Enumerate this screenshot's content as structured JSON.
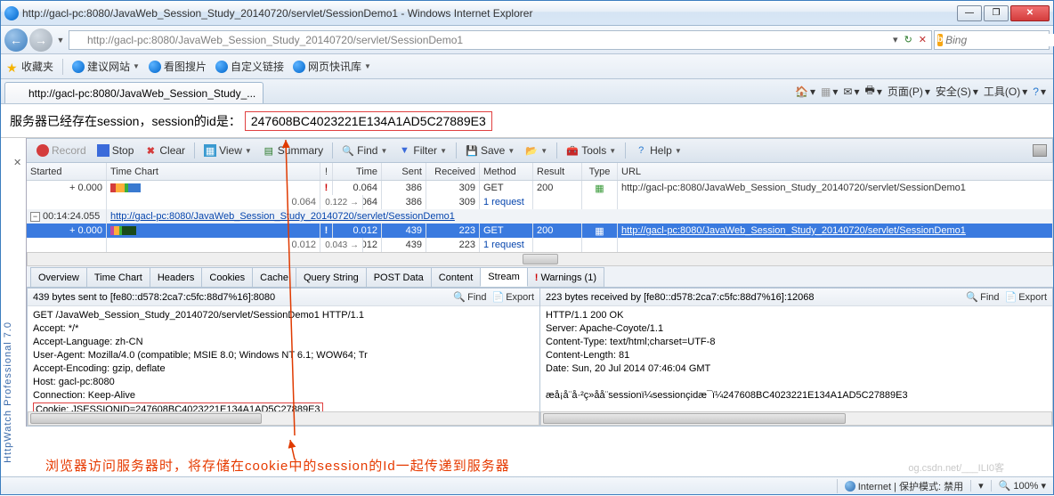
{
  "window": {
    "title": "http://gacl-pc:8080/JavaWeb_Session_Study_20140720/servlet/SessionDemo1 - Windows Internet Explorer"
  },
  "nav": {
    "url": "http://gacl-pc:8080/JavaWeb_Session_Study_20140720/servlet/SessionDemo1",
    "search_placeholder": "Bing"
  },
  "favbar": {
    "favorites": "收藏夹",
    "suggest": "建议网站",
    "images": "看图搜片",
    "custom": "自定义链接",
    "news": "网页快讯库"
  },
  "tab": {
    "label": "http://gacl-pc:8080/JavaWeb_Session_Study_..."
  },
  "cmdbar": {
    "page": "页面(P)",
    "safety": "安全(S)",
    "tools": "工具(O)"
  },
  "page": {
    "prefix": "服务器已经存在session，session的id是：",
    "session_id": "247608BC4023221E134A1AD5C27889E3"
  },
  "toolbar": {
    "record": "Record",
    "stop": "Stop",
    "clear": "Clear",
    "view": "View",
    "summary": "Summary",
    "find": "Find",
    "filter": "Filter",
    "save": "Save",
    "tools": "Tools",
    "help": "Help"
  },
  "grid": {
    "headers": {
      "started": "Started",
      "time_chart": "Time Chart",
      "bang": "!",
      "time": "Time",
      "sent": "Sent",
      "received": "Received",
      "method": "Method",
      "result": "Result",
      "type": "Type",
      "url": "URL"
    },
    "rows": [
      {
        "started": "+ 0.000",
        "bang": "!",
        "time": "0.064",
        "sent": "386",
        "recv": "309",
        "method": "GET",
        "result": "200",
        "url": "http://gacl-pc:8080/JavaWeb_Session_Study_20140720/servlet/SessionDemo1"
      },
      {
        "started": "",
        "tc_right": "0.064",
        "bang_right": "0.122",
        "time": "0.064",
        "sent": "386",
        "recv": "309",
        "method": "1 request",
        "result": "",
        "url": ""
      },
      {
        "group": true,
        "started": "00:14:24.055",
        "url_group": "http://gacl-pc:8080/JavaWeb_Session_Study_20140720/servlet/SessionDemo1"
      },
      {
        "sel": true,
        "started": "+ 0.000",
        "bang": "!",
        "time": "0.012",
        "sent": "439",
        "recv": "223",
        "method": "GET",
        "result": "200",
        "url": "http://gacl-pc:8080/JavaWeb_Session_Study_20140720/servlet/SessionDemo1"
      },
      {
        "started": "",
        "tc_right": "0.012",
        "bang_right": "0.043",
        "time": "0.012",
        "sent": "439",
        "recv": "223",
        "method": "1 request",
        "result": "",
        "url": ""
      }
    ]
  },
  "mid_tabs": {
    "overview": "Overview",
    "time_chart": "Time Chart",
    "headers": "Headers",
    "cookies": "Cookies",
    "cache": "Cache",
    "query": "Query String",
    "post": "POST Data",
    "content": "Content",
    "stream": "Stream",
    "warnings": "Warnings (1)"
  },
  "left_panel": {
    "title": "439 bytes sent to  [fe80::d578:2ca7:c5fc:88d7%16]:8080",
    "find": "Find",
    "export": "Export",
    "l1": "GET /JavaWeb_Session_Study_20140720/servlet/SessionDemo1 HTTP/1.1",
    "l2": "Accept: */*",
    "l3": "Accept-Language: zh-CN",
    "l4": "User-Agent: Mozilla/4.0 (compatible; MSIE 8.0; Windows NT 6.1; WOW64; Tr",
    "l5": "Accept-Encoding: gzip, deflate",
    "l6": "Host: gacl-pc:8080",
    "l7": "Connection: Keep-Alive",
    "cookie": "Cookie: JSESSIONID=247608BC4023221E134A1AD5C27889E3"
  },
  "right_panel": {
    "title": "223 bytes received by  [fe80::d578:2ca7:c5fc:88d7%16]:12068",
    "find": "Find",
    "export": "Export",
    "l1": "HTTP/1.1 200 OK",
    "l2": "Server: Apache-Coyote/1.1",
    "l3": "Content-Type: text/html;charset=UTF-8",
    "l4": "Content-Length: 81",
    "l5": "Date: Sun, 20 Jul 2014 07:46:04 GMT",
    "l6": "",
    "l7": "æå¡å¨å·²ç»å­å¨sessionï¼sessionçidæ¯ï¼247608BC4023221E134A1AD5C27889E3"
  },
  "annotation": {
    "text": "浏览器访问服务器时，将存储在cookie中的session的Id一起传递到服务器"
  },
  "status": {
    "internet": "Internet | 保护模式: 禁用",
    "zoom": "100%"
  },
  "hw_label": "HttpWatch Professional 7.0",
  "watermark": "og.csdn.net/___ILI0客"
}
